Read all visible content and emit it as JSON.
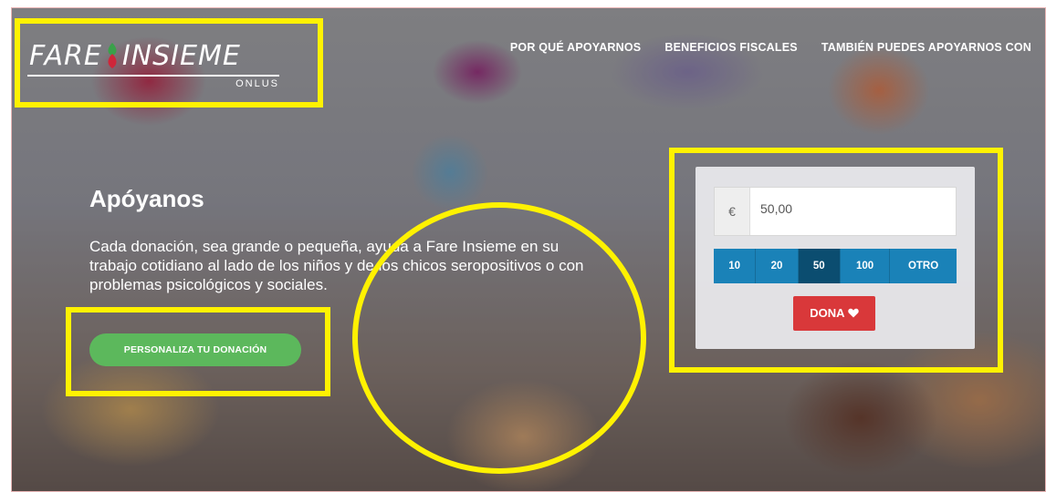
{
  "logo": {
    "text_left": "FARE",
    "text_right": "INSIEME",
    "subtitle": "ONLUS"
  },
  "nav": {
    "items": [
      {
        "label": "POR QUÉ APOYARNOS"
      },
      {
        "label": "BENEFICIOS FISCALES"
      },
      {
        "label": "TAMBIÉN PUEDES APOYARNOS CON"
      }
    ]
  },
  "hero": {
    "title": "Apóyanos",
    "text": "Cada donación, sea grande o pequeña, ayuda a Fare Insieme en su trabajo cotidiano al lado de los niños y de los chicos seropositivos o con problemas psicológicos y sociales.",
    "cta_label": "PERSONALIZA TU DONACIÓN"
  },
  "donation": {
    "currency_symbol": "€",
    "amount_value": "50,00",
    "amounts": [
      "10",
      "20",
      "50",
      "100",
      "OTRO"
    ],
    "selected_amount": "50",
    "donate_label": "DONA",
    "donate_icon": "heart-icon"
  },
  "colors": {
    "cta_green": "#5cb85c",
    "amount_blue": "#1a82b8",
    "amount_selected": "#0b4d70",
    "donate_red": "#d9383a",
    "annotation_yellow": "#fff200"
  }
}
